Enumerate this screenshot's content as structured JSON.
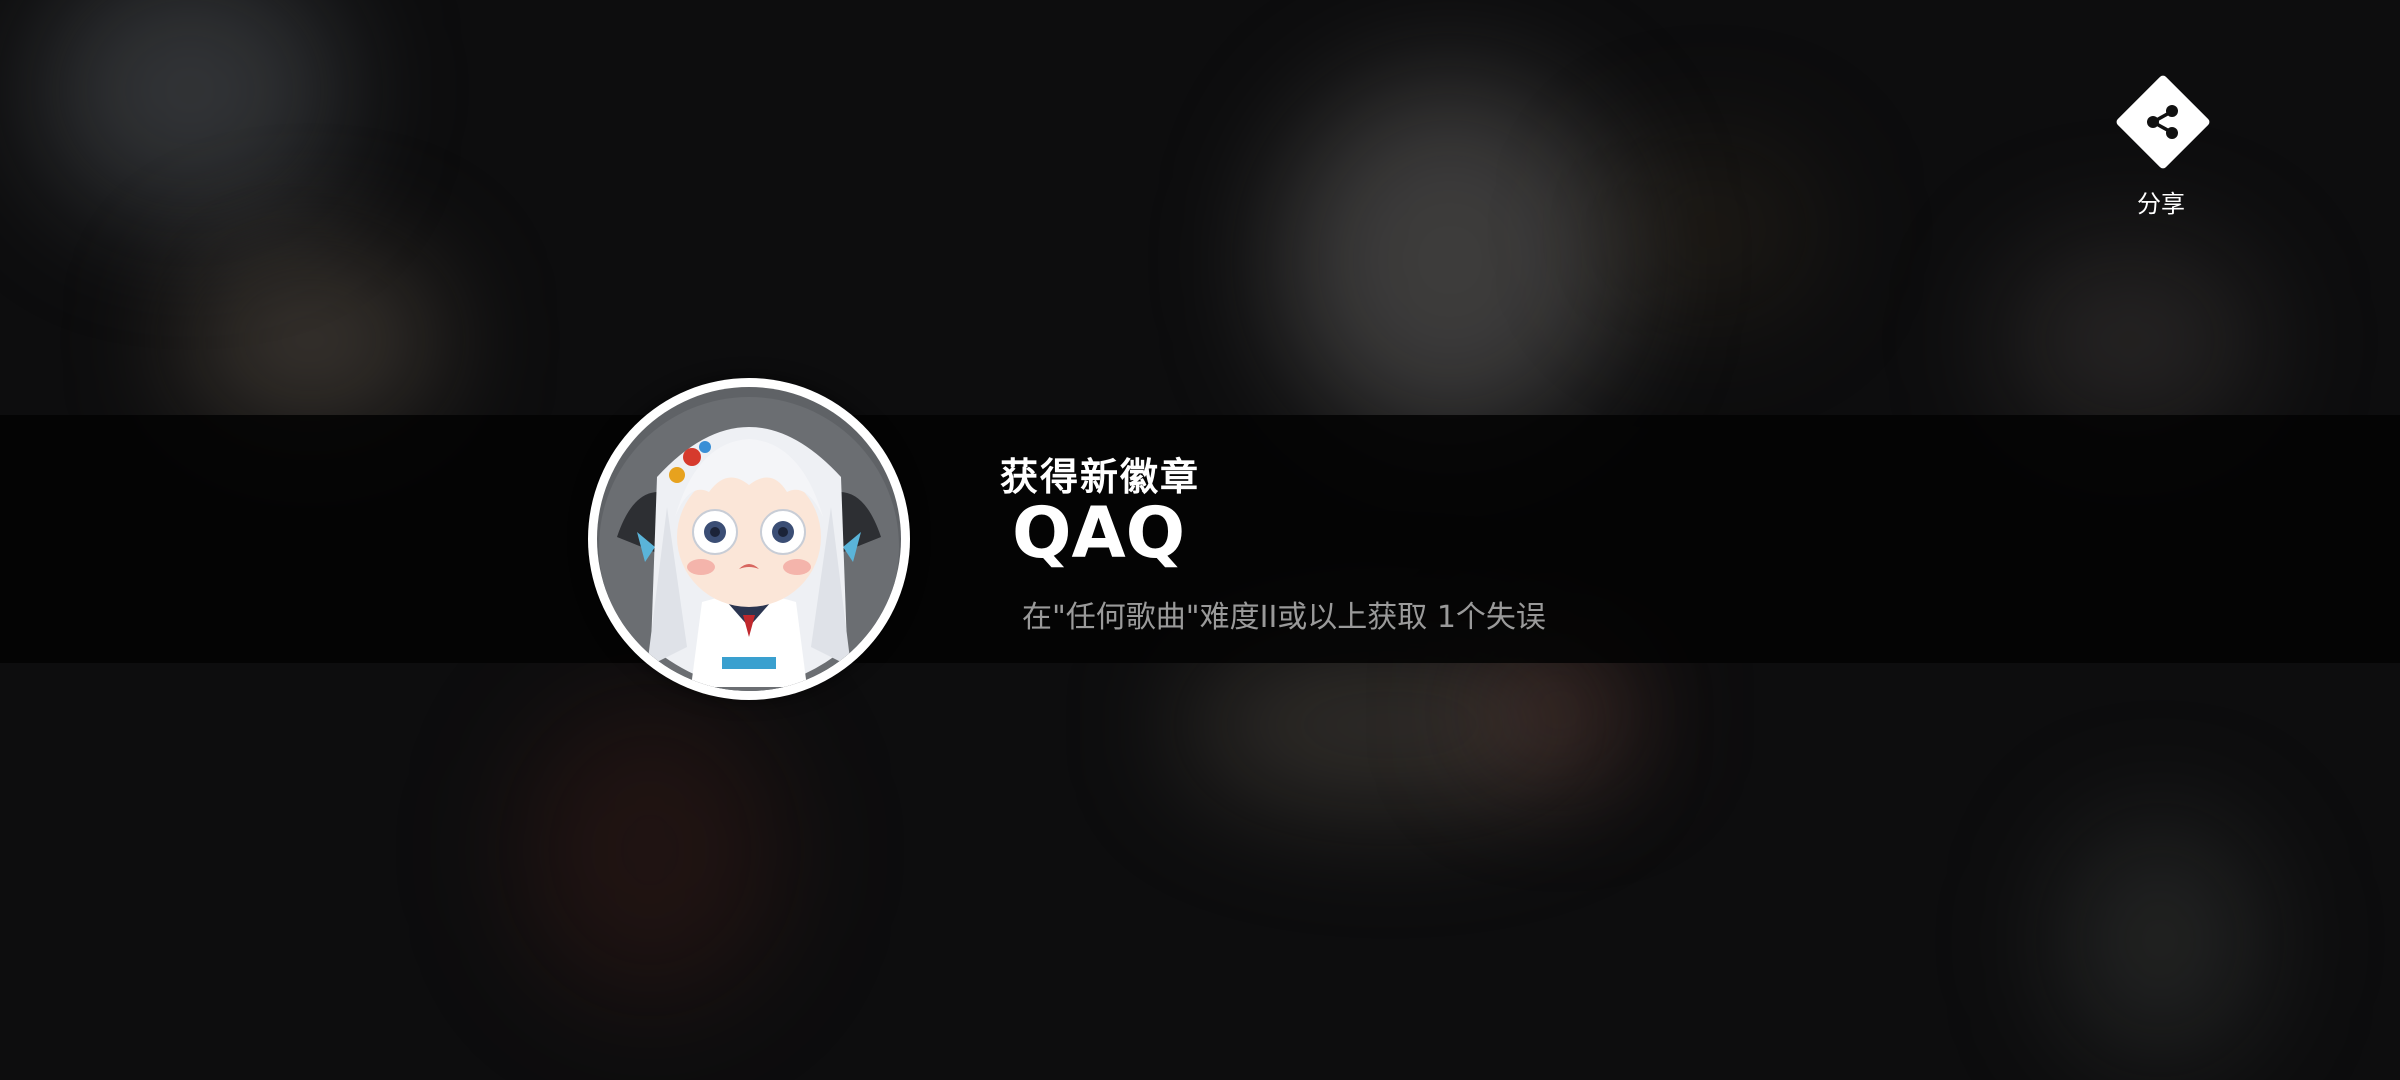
{
  "notification": {
    "kicker": "获得新徽章",
    "badge_name": "QAQ",
    "condition": "在\"任何歌曲\"难度II或以上获取 1个失误"
  },
  "share": {
    "label": "分享",
    "icon": "share-icon"
  },
  "badge": {
    "icon": "crying-girl-badge-icon"
  }
}
